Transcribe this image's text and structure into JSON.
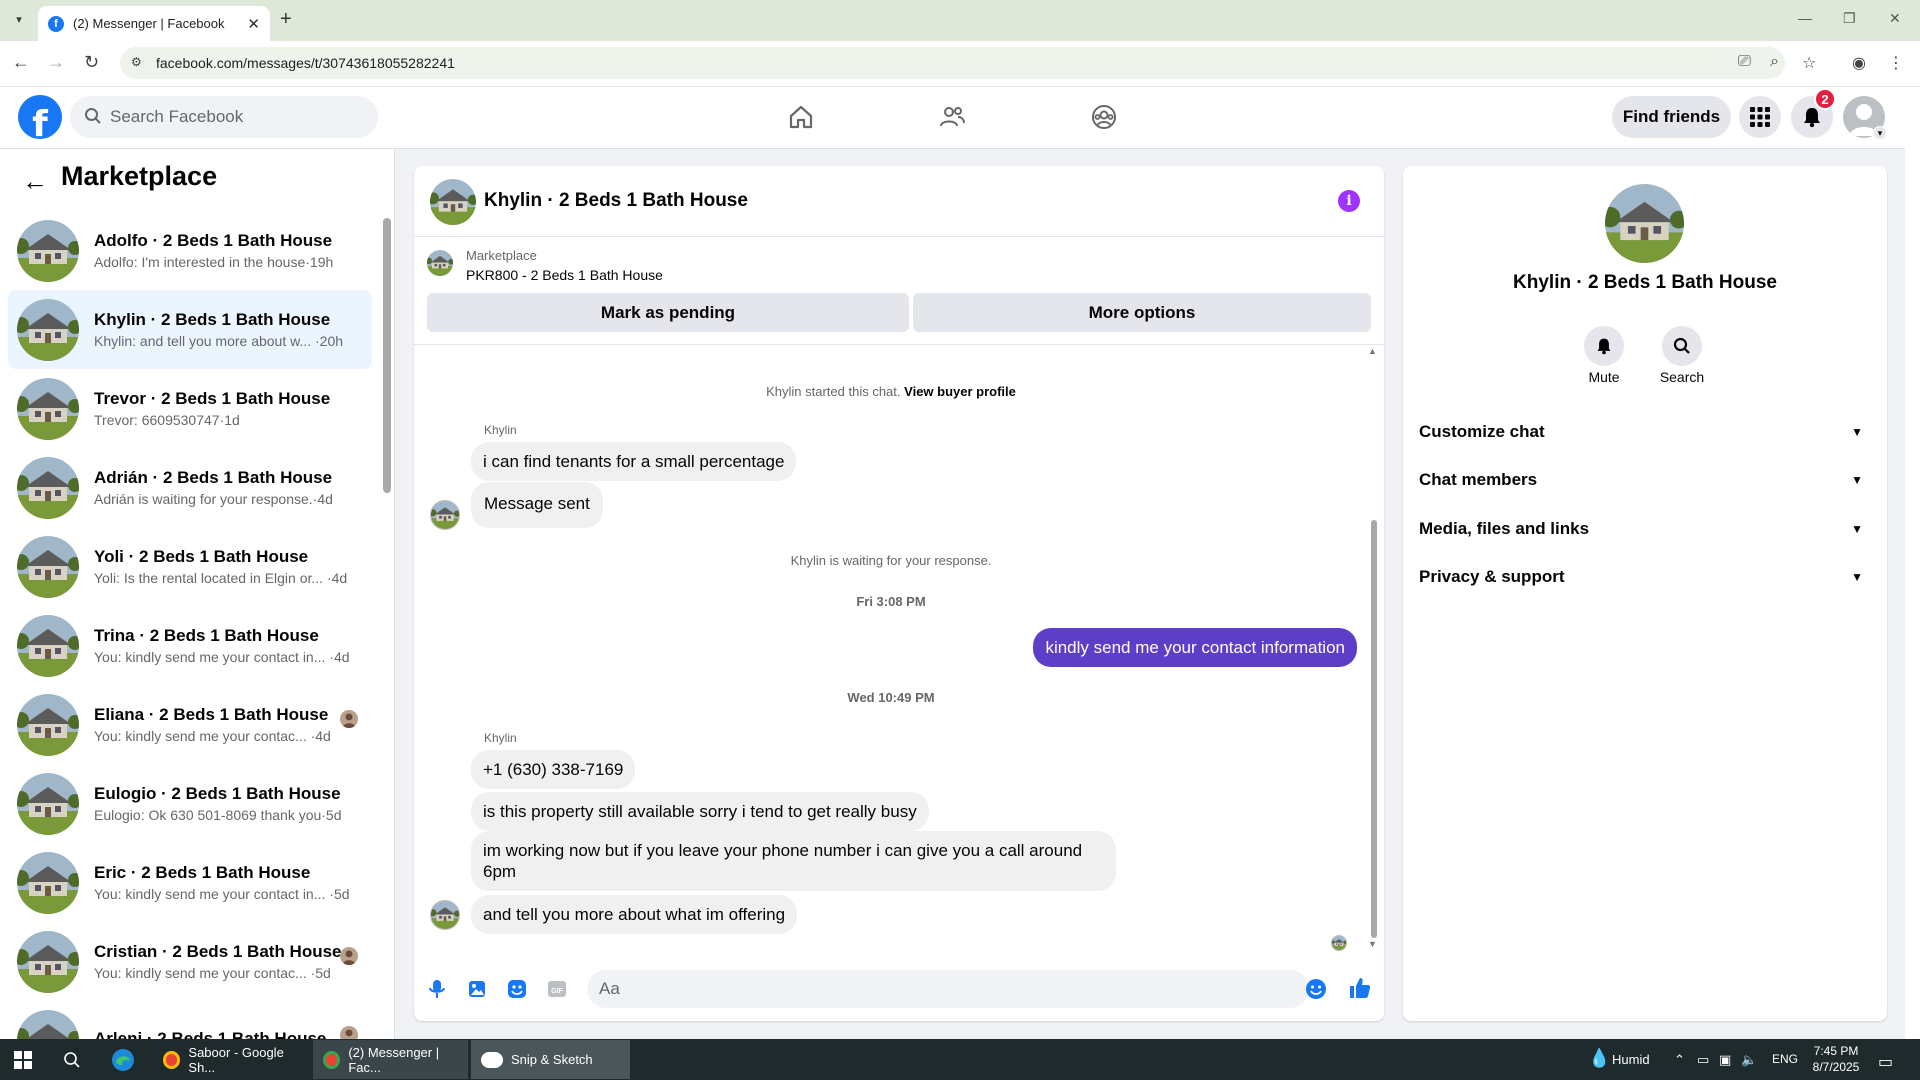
{
  "browser": {
    "tab_title": "(2) Messenger | Facebook",
    "url": "facebook.com/messages/t/30743618055282241"
  },
  "fb": {
    "search_placeholder": "Search Facebook",
    "find_friends": "Find friends",
    "notification_count": "2"
  },
  "sidebar": {
    "title": "Marketplace",
    "conversations": [
      {
        "name": "Adolfo · 2 Beds 1 Bath House",
        "preview": "Adolfo: I'm interested in the house·19h",
        "active": false,
        "mini": false
      },
      {
        "name": "Khylin · 2 Beds 1 Bath House",
        "preview": "Khylin: and tell you more about w... ·20h",
        "active": true,
        "mini": false
      },
      {
        "name": "Trevor · 2 Beds 1 Bath House",
        "preview": "Trevor: 6609530747·1d",
        "active": false,
        "mini": false
      },
      {
        "name": "Adrián · 2 Beds 1 Bath House",
        "preview": "Adrián is waiting for your response.·4d",
        "active": false,
        "mini": false
      },
      {
        "name": "Yoli · 2 Beds 1 Bath House",
        "preview": "Yoli: Is the rental located in Elgin or... ·4d",
        "active": false,
        "mini": false
      },
      {
        "name": "Trina · 2 Beds 1 Bath House",
        "preview": "You: kindly send me your contact in... ·4d",
        "active": false,
        "mini": false
      },
      {
        "name": "Eliana · 2 Beds 1 Bath House",
        "preview": "You: kindly send me your contac... ·4d",
        "active": false,
        "mini": true
      },
      {
        "name": "Eulogio · 2 Beds 1 Bath House",
        "preview": "Eulogio: Ok 630 501-8069 thank you·5d",
        "active": false,
        "mini": false
      },
      {
        "name": "Eric · 2 Beds 1 Bath House",
        "preview": "You: kindly send me your contact in... ·5d",
        "active": false,
        "mini": false
      },
      {
        "name": "Cristian · 2 Beds 1 Bath House",
        "preview": "You: kindly send me your contac... ·5d",
        "active": false,
        "mini": true
      },
      {
        "name": "Arleni · 2 Beds 1 Bath House",
        "preview": "",
        "active": false,
        "mini": true
      }
    ]
  },
  "chat": {
    "header_name": "Khylin · 2 Beds 1 Bath House",
    "marketplace_label": "Marketplace",
    "listing": "PKR800 - 2 Beds 1 Bath House",
    "mark_pending": "Mark as pending",
    "more_options": "More options",
    "started_text": "Khylin started this chat.",
    "view_buyer_profile": "View buyer profile",
    "sender_name": "Khylin",
    "msg1": "i can find tenants for a small percentage",
    "msg2": "Message sent",
    "waiting_text": "Khylin is waiting for your response.",
    "time1": "Fri 3:08 PM",
    "my_msg": "kindly send me your contact information",
    "time2": "Wed 10:49 PM",
    "msg3": "+1 (630) 338-7169",
    "msg4": "is this property still available sorry i tend to get really busy",
    "msg5": "im working now but if you leave your phone number i can give you a call around 6pm",
    "msg6": "and tell you more about what im offering",
    "composer_placeholder": "Aa"
  },
  "right_panel": {
    "name": "Khylin · 2 Beds 1 Bath House",
    "mute": "Mute",
    "search": "Search",
    "rows": [
      "Customize chat",
      "Chat members",
      "Media, files and links",
      "Privacy & support"
    ]
  },
  "taskbar": {
    "item1": "Saboor - Google Sh...",
    "item2": "(2) Messenger | Fac...",
    "item3": "Snip & Sketch",
    "weather": "Humid",
    "lang": "ENG",
    "time": "7:45 PM",
    "date": "8/7/2025"
  },
  "colors": {
    "fb_blue": "#1877f2",
    "my_bubble": "#5d3ec9",
    "info_purple": "#a033ff",
    "badge_red": "#e41e3f"
  }
}
